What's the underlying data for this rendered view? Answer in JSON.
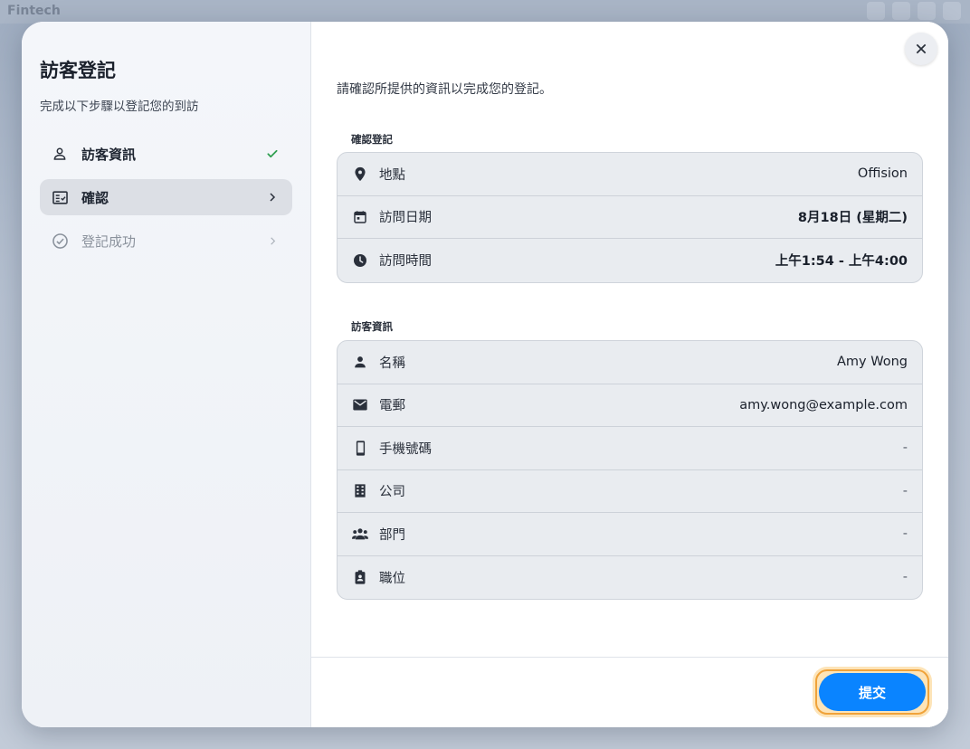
{
  "background": {
    "app_title": "Fintech"
  },
  "sidebar": {
    "title": "訪客登記",
    "subtitle": "完成以下步驟以登記您的到訪",
    "steps": [
      {
        "label": "訪客資訊",
        "icon": "person-icon",
        "status": "complete"
      },
      {
        "label": "確認",
        "icon": "checklist-icon",
        "status": "active"
      },
      {
        "label": "登記成功",
        "icon": "check-circle-icon",
        "status": "pending"
      }
    ]
  },
  "main": {
    "intro": "請確認所提供的資訊以完成您的登記。",
    "registration": {
      "heading": "確認登記",
      "rows": [
        {
          "icon": "location-pin-icon",
          "label": "地點",
          "value": "Offision"
        },
        {
          "icon": "calendar-icon",
          "label": "訪問日期",
          "value": "8月18日 (星期二)"
        },
        {
          "icon": "clock-icon",
          "label": "訪問時間",
          "value": "上午1:54 - 上午4:00"
        }
      ]
    },
    "visitor": {
      "heading": "訪客資訊",
      "rows": [
        {
          "icon": "person-icon",
          "label": "名稱",
          "value": "Amy Wong"
        },
        {
          "icon": "mail-icon",
          "label": "電郵",
          "value": "amy.wong@example.com"
        },
        {
          "icon": "mobile-phone-icon",
          "label": "手機號碼",
          "value": "-"
        },
        {
          "icon": "building-icon",
          "label": "公司",
          "value": "-"
        },
        {
          "icon": "group-icon",
          "label": "部門",
          "value": "-"
        },
        {
          "icon": "badge-icon",
          "label": "職位",
          "value": "-"
        }
      ]
    },
    "submit_label": "提交"
  },
  "colors": {
    "accent": "#0a84ff",
    "success": "#2e9e4f",
    "focus_ring": "#f0a33a"
  }
}
